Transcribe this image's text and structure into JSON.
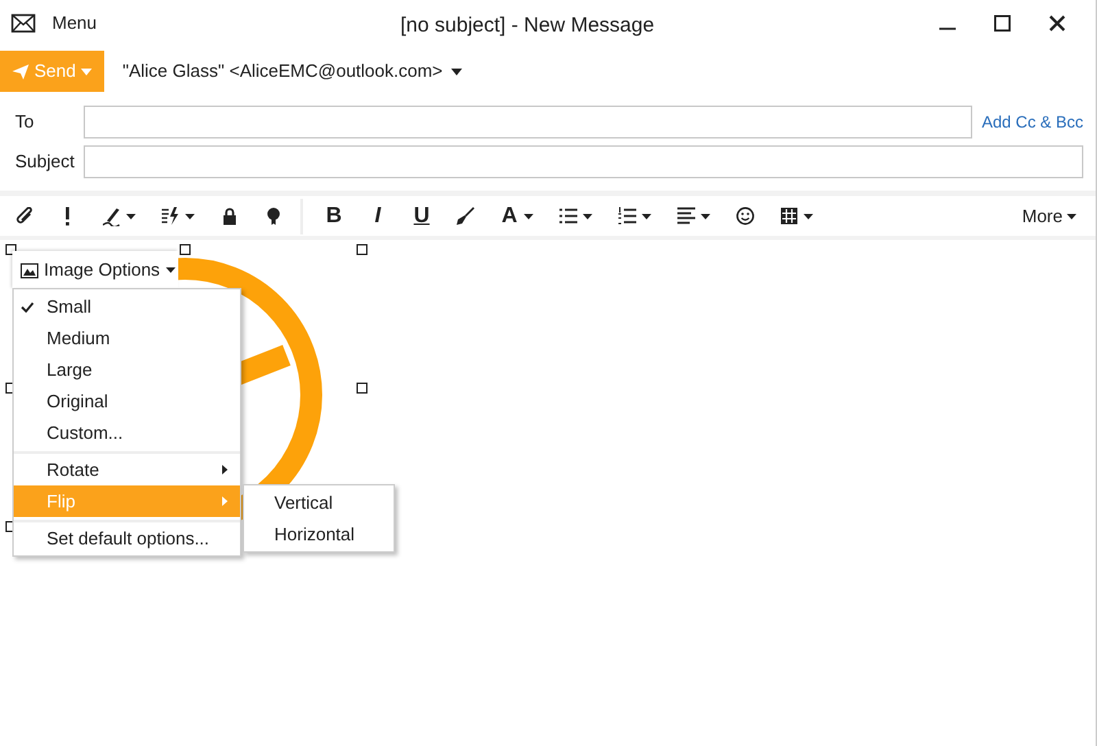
{
  "window": {
    "title": "[no subject] - New Message",
    "menu_label": "Menu"
  },
  "send": {
    "label": "Send",
    "from": "\"Alice Glass\" <AliceEMC@outlook.com>"
  },
  "fields": [
    {
      "label": "To",
      "kind": "to"
    },
    {
      "label": "Subject",
      "kind": "subject"
    }
  ],
  "add_cc_bcc": "Add Cc & Bcc",
  "toolbar": {
    "items": [
      {
        "kind": "attach"
      },
      {
        "kind": "important"
      },
      {
        "kind": "signature",
        "dropdown": true
      },
      {
        "kind": "quick",
        "dropdown": true
      },
      {
        "kind": "lock"
      },
      {
        "kind": "ribbon"
      },
      {
        "kind": "sep"
      },
      {
        "kind": "bold",
        "label": "B"
      },
      {
        "kind": "italic",
        "label": "I"
      },
      {
        "kind": "underline",
        "label": "U"
      },
      {
        "kind": "brush"
      },
      {
        "kind": "font_color",
        "label": "A",
        "dropdown": true
      },
      {
        "kind": "bullets",
        "dropdown": true
      },
      {
        "kind": "numbers",
        "dropdown": true
      },
      {
        "kind": "align",
        "dropdown": true
      },
      {
        "kind": "smiley"
      },
      {
        "kind": "table",
        "dropdown": true
      }
    ],
    "more": "More"
  },
  "image_menu": {
    "title": "Image Options",
    "items": [
      {
        "label": "Small",
        "checked": true,
        "selected": false,
        "submenu": false,
        "separator_before": false
      },
      {
        "label": "Medium",
        "checked": false,
        "selected": false,
        "submenu": false,
        "separator_before": false
      },
      {
        "label": "Large",
        "checked": false,
        "selected": false,
        "submenu": false,
        "separator_before": false
      },
      {
        "label": "Original",
        "checked": false,
        "selected": false,
        "submenu": false,
        "separator_before": false
      },
      {
        "label": "Custom...",
        "checked": false,
        "selected": false,
        "submenu": false,
        "separator_before": false
      },
      {
        "label": "Rotate",
        "checked": false,
        "selected": false,
        "submenu": true,
        "separator_before": true
      },
      {
        "label": "Flip",
        "checked": false,
        "selected": true,
        "submenu": true,
        "separator_before": false
      },
      {
        "label": "Set default options...",
        "checked": false,
        "selected": false,
        "submenu": false,
        "separator_before": true
      }
    ],
    "submenu": [
      "Vertical",
      "Horizontal"
    ]
  }
}
